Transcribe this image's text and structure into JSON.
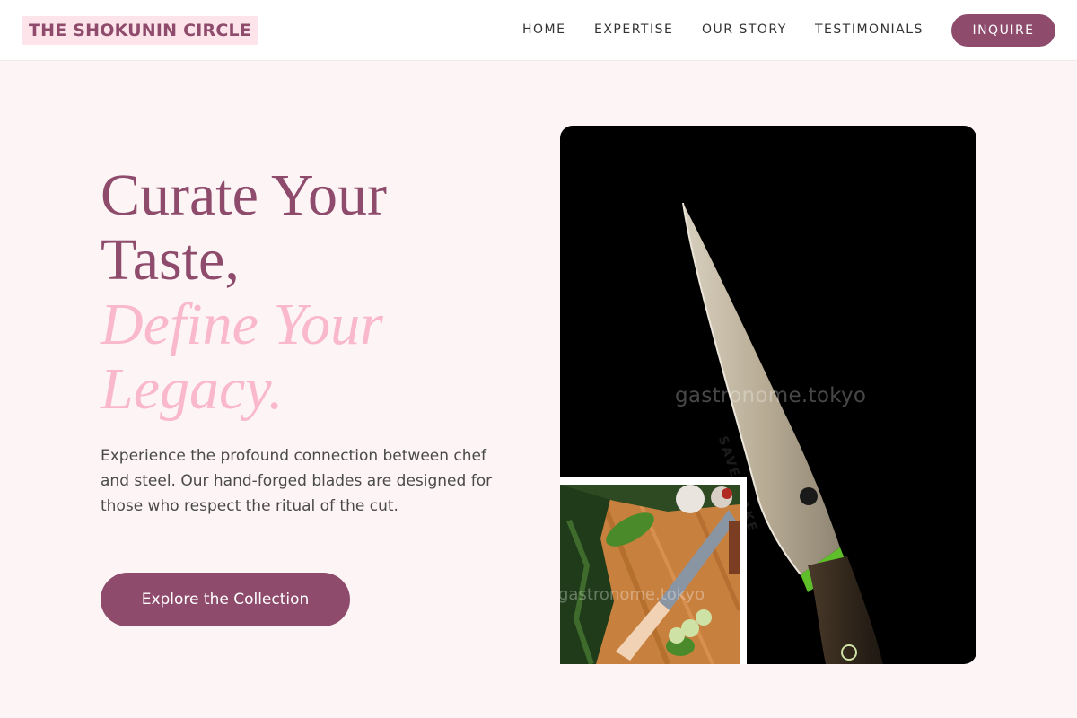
{
  "header": {
    "logo": "THE SHOKUNIN CIRCLE",
    "nav": [
      "HOME",
      "EXPERTISE",
      "OUR STORY",
      "TESTIMONIALS"
    ],
    "cta": "INQUIRE"
  },
  "hero": {
    "title_line1": "Curate Your Taste,",
    "title_line2": "Define Your Legacy.",
    "description": "Experience the profound connection between chef and steel. Our hand-forged blades are designed for those who respect the ritual of the cut.",
    "button": "Explore the Collection"
  },
  "images": {
    "main": {
      "watermark": "gastronome.tokyo",
      "blade_brand": "SAVERNAKE"
    },
    "inset": {
      "watermark": "gastronome.tokyo"
    }
  },
  "colors": {
    "brand": "#8e4b6c",
    "accent_pink": "#f9b8cc",
    "background": "#fdf4f5",
    "logo_bg": "#fde4ea"
  },
  "icons": {
    "carousel_dot": "circle-outline-icon"
  }
}
